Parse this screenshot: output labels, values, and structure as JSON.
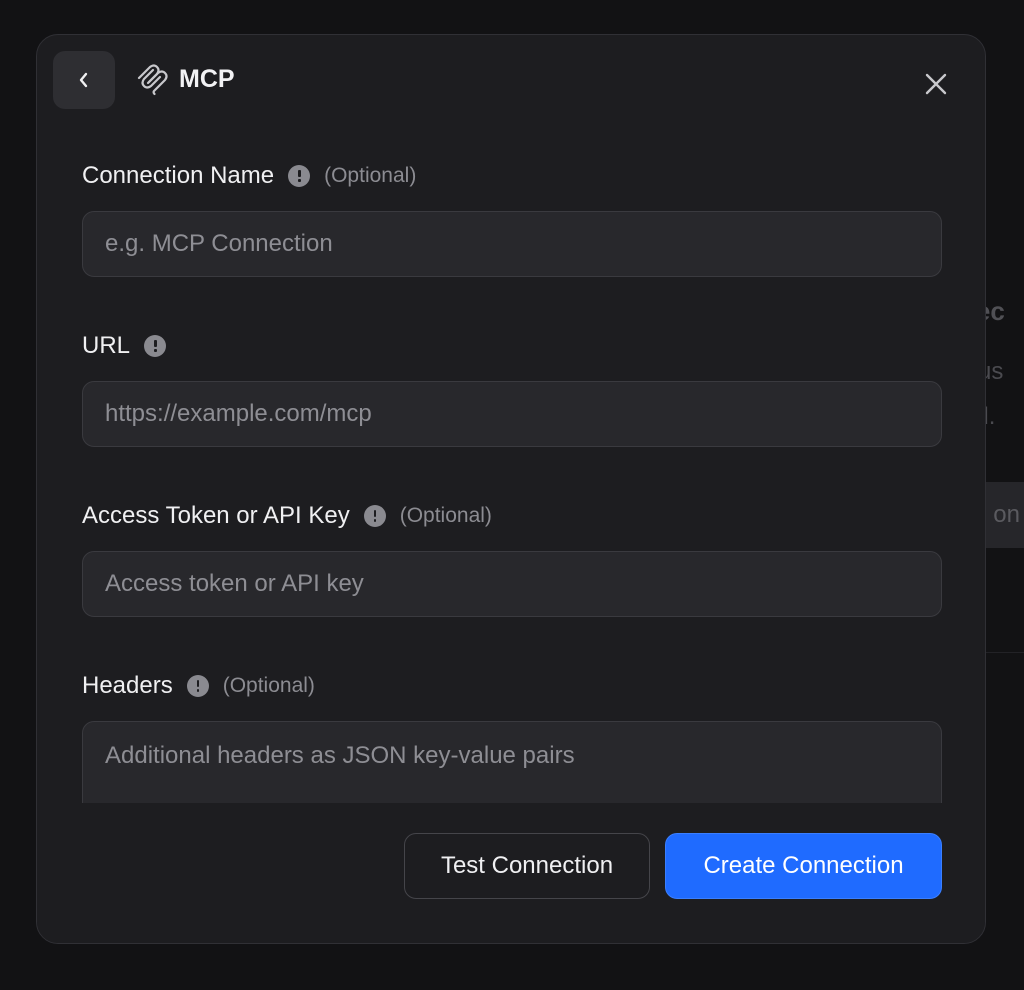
{
  "background": {
    "heading_fragment": "nec",
    "line1_fragment": "us",
    "line2_fragment": "ed.",
    "button_fragment": "on"
  },
  "modal": {
    "title": "MCP",
    "back_icon": "chevron-left-icon",
    "logo_icon": "mcp-logo-icon",
    "close_icon": "close-icon"
  },
  "fields": {
    "connection_name": {
      "label": "Connection Name",
      "optional": "(Optional)",
      "value": "",
      "placeholder": "e.g. MCP Connection"
    },
    "url": {
      "label": "URL",
      "value": "",
      "placeholder": "https://example.com/mcp"
    },
    "access_token": {
      "label": "Access Token or API Key",
      "optional": "(Optional)",
      "value": "",
      "placeholder": "Access token or API key"
    },
    "headers": {
      "label": "Headers",
      "optional": "(Optional)",
      "value": "",
      "placeholder": "Additional headers as JSON key-value pairs"
    }
  },
  "footer": {
    "test_label": "Test Connection",
    "create_label": "Create Connection"
  },
  "colors": {
    "page_background": "#121214",
    "modal_background": "#1d1d20",
    "input_background": "#28282c",
    "primary_accent": "#1f6bff",
    "info_icon": "#8a8a90"
  }
}
